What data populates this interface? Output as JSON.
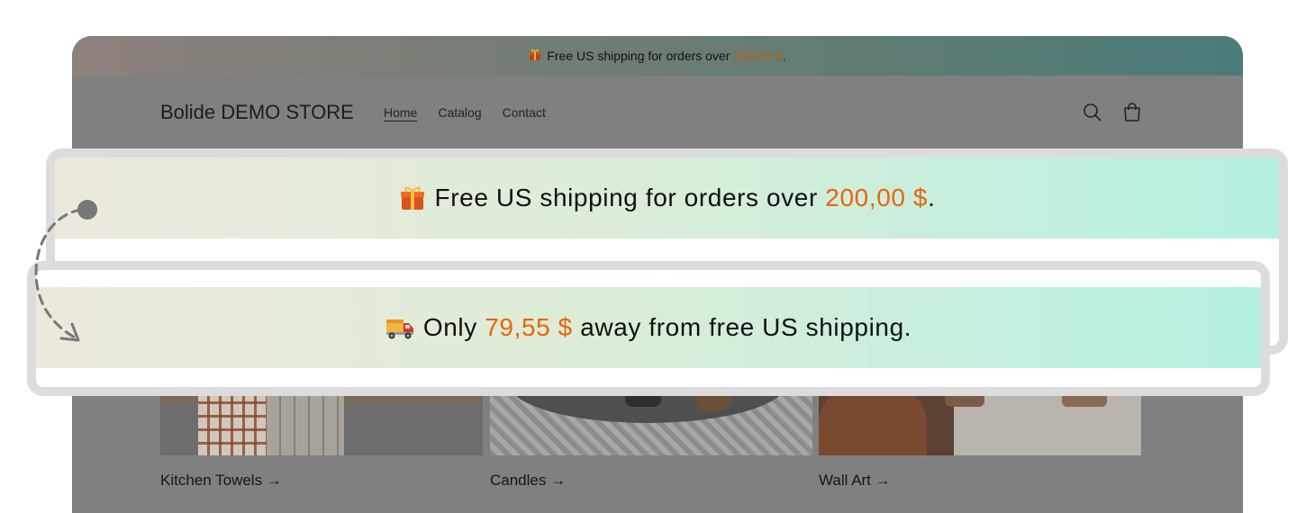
{
  "store": {
    "announcement": {
      "prefix": "Free US shipping for orders over",
      "amount": "200,00 $",
      "suffix": "."
    },
    "logo": "Bolide DEMO STORE",
    "nav": [
      "Home",
      "Catalog",
      "Contact"
    ],
    "collections": [
      {
        "title": "Kitchen Towels →"
      },
      {
        "title": "Candles →"
      },
      {
        "title": "Wall Art →"
      }
    ]
  },
  "bars": {
    "free_shipping": {
      "prefix": "Free US shipping for orders over",
      "amount": "200,00 $",
      "suffix": "."
    },
    "progress": {
      "prefix": "Only",
      "amount": "79,55 $",
      "suffix": "away from free US shipping."
    }
  },
  "colors": {
    "accent": "#e8650a",
    "bar_gradient_start": "#ece9dc",
    "bar_gradient_end": "#b4f0e2",
    "frame": "#dcdcdc"
  },
  "icons": [
    "gift-icon",
    "truck-icon",
    "search-icon",
    "cart-icon",
    "curved-arrow-icon"
  ]
}
